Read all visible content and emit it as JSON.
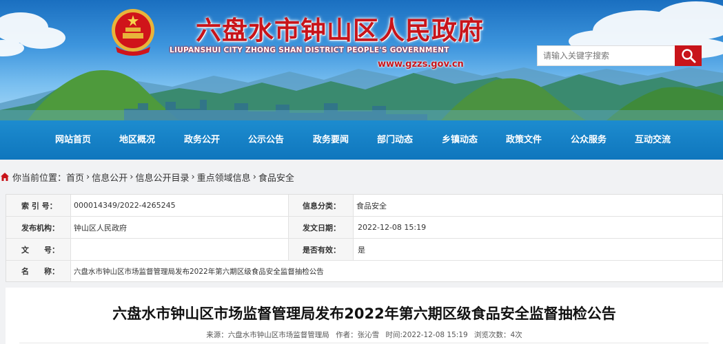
{
  "header": {
    "title": "六盘水市钟山区人民政府",
    "title_en": "LIUPANSHUI CITY ZHONG SHAN DISTRICT PEOPLE'S GOVERNMENT",
    "url": "www.gzzs.gov.cn",
    "search_placeholder": "请输入关键字搜索"
  },
  "nav": {
    "items": [
      "网站首页",
      "地区概况",
      "政务公开",
      "公示公告",
      "政务要闻",
      "部门动态",
      "乡镇动态",
      "政策文件",
      "公众服务",
      "互动交流"
    ]
  },
  "breadcrumb": {
    "prefix": "你当前位置：",
    "items": [
      "首页",
      "信息公开",
      "信息公开目录",
      "重点领域信息",
      "食品安全"
    ],
    "separator": "›"
  },
  "info": {
    "index_label": "索 引 号：",
    "index_value": "000014349/2022-4265245",
    "category_label": "信息分类：",
    "category_value": "食品安全",
    "publisher_label": "发布机构：",
    "publisher_value": "钟山区人民政府",
    "date_label": "发文日期：",
    "date_value": "2022-12-08 15:19",
    "docno_label": "文　　号：",
    "docno_value": "",
    "valid_label": "是否有效：",
    "valid_value": "是",
    "name_label": "名　　称：",
    "name_value": "六盘水市钟山区市场监督管理局发布2022年第六期区级食品安全监督抽检公告"
  },
  "article": {
    "title": "六盘水市钟山区市场监督管理局发布2022年第六期区级食品安全监督抽检公告",
    "source_label": "来源：",
    "source_value": "六盘水市钟山区市场监督管理局",
    "author_label": "作者：",
    "author_value": "张沁雪",
    "time_label": "时间:",
    "time_value": "2022-12-08 15:19",
    "views_label": "浏览次数：",
    "views_value": "4次"
  },
  "colors": {
    "brand_red": "#c8141a",
    "nav_blue": "#0f76bd",
    "sky_blue": "#3d95dd"
  }
}
